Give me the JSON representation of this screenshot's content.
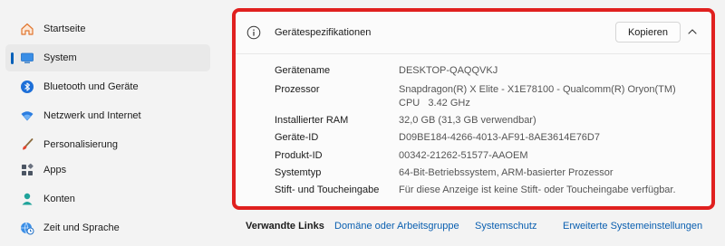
{
  "sidebar": {
    "items": [
      {
        "label": "Startseite",
        "icon": "home-icon"
      },
      {
        "label": "System",
        "icon": "monitor-icon",
        "selected": true
      },
      {
        "label": "Bluetooth und Geräte",
        "icon": "bluetooth-icon"
      },
      {
        "label": "Netzwerk und Internet",
        "icon": "wifi-icon"
      },
      {
        "label": "Personalisierung",
        "icon": "brush-icon"
      },
      {
        "label": "Apps",
        "icon": "apps-icon"
      },
      {
        "label": "Konten",
        "icon": "account-icon"
      },
      {
        "label": "Zeit und Sprache",
        "icon": "globe-clock-icon"
      }
    ]
  },
  "specs": {
    "title": "Gerätespezifikationen",
    "copy_label": "Kopieren",
    "rows": [
      {
        "label": "Gerätename",
        "value": "DESKTOP-QAQQVKJ",
        "value2": ""
      },
      {
        "label": "Prozessor",
        "value": "Snapdragon(R) X Elite - X1E78100 - Qualcomm(R) Oryon(TM)",
        "value2": "CPU   3.42 GHz"
      },
      {
        "label": "Installierter RAM",
        "value": "32,0 GB (31,3 GB verwendbar)",
        "value2": ""
      },
      {
        "label": "Geräte-ID",
        "value": "D09BE184-4266-4013-AF91-8AE3614E76D7",
        "value2": ""
      },
      {
        "label": "Produkt-ID",
        "value": "00342-21262-51577-AAOEM",
        "value2": ""
      },
      {
        "label": "Systemtyp",
        "value": "64-Bit-Betriebssystem, ARM-basierter Prozessor",
        "value2": ""
      },
      {
        "label": "Stift- und Toucheingabe",
        "value": "Für diese Anzeige ist keine Stift- oder Toucheingabe verfügbar.",
        "value2": ""
      }
    ]
  },
  "related": {
    "title": "Verwandte Links",
    "links": [
      "Domäne oder Arbeitsgruppe",
      "Systemschutz",
      "Erweiterte Systemeinstellungen"
    ]
  },
  "colors": {
    "accent": "#005fb8",
    "highlight": "#e0201f",
    "link": "#0a5fb0"
  }
}
